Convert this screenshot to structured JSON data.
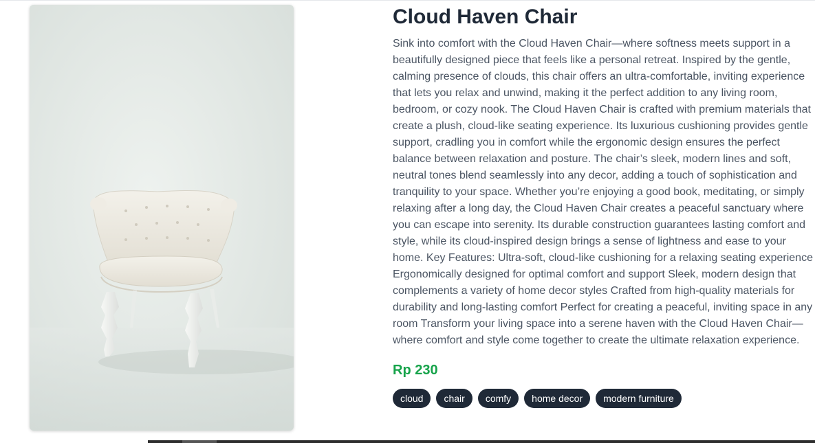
{
  "product": {
    "image_alt": "white tufted chair",
    "name": "Cloud Haven Chair",
    "description": "Sink into comfort with the Cloud Haven Chair—where softness meets support in a beautifully designed piece that feels like a personal retreat. Inspired by the gentle, calming presence of clouds, this chair offers an ultra-comfortable, inviting experience that lets you relax and unwind, making it the perfect addition to any living room, bedroom, or cozy nook. The Cloud Haven Chair is crafted with premium materials that create a plush, cloud-like seating experience. Its luxurious cushioning provides gentle support, cradling you in comfort while the ergonomic design ensures the perfect balance between relaxation and posture. The chair’s sleek, modern lines and soft, neutral tones blend seamlessly into any decor, adding a touch of sophistication and tranquility to your space. Whether you’re enjoying a good book, meditating, or simply relaxing after a long day, the Cloud Haven Chair creates a peaceful sanctuary where you can escape into serenity. Its durable construction guarantees lasting comfort and style, while its cloud-inspired design brings a sense of lightness and ease to your home. Key Features: Ultra-soft, cloud-like cushioning for a relaxing seating experience Ergonomically designed for optimal comfort and support Sleek, modern design that complements a variety of home decor styles Crafted from high-quality materials for durability and long-lasting comfort Perfect for creating a peaceful, inviting space in any room Transform your living space into a serene haven with the Cloud Haven Chair—where comfort and style come together to create the ultimate relaxation experience.",
    "price": "Rp 230",
    "tags": [
      "cloud",
      "chair",
      "comfy",
      "home decor",
      "modern furniture"
    ]
  },
  "colors": {
    "title": "#1f2937",
    "price": "#16a34a",
    "tag_bg": "#1f2937",
    "tag_text": "#ffffff"
  }
}
